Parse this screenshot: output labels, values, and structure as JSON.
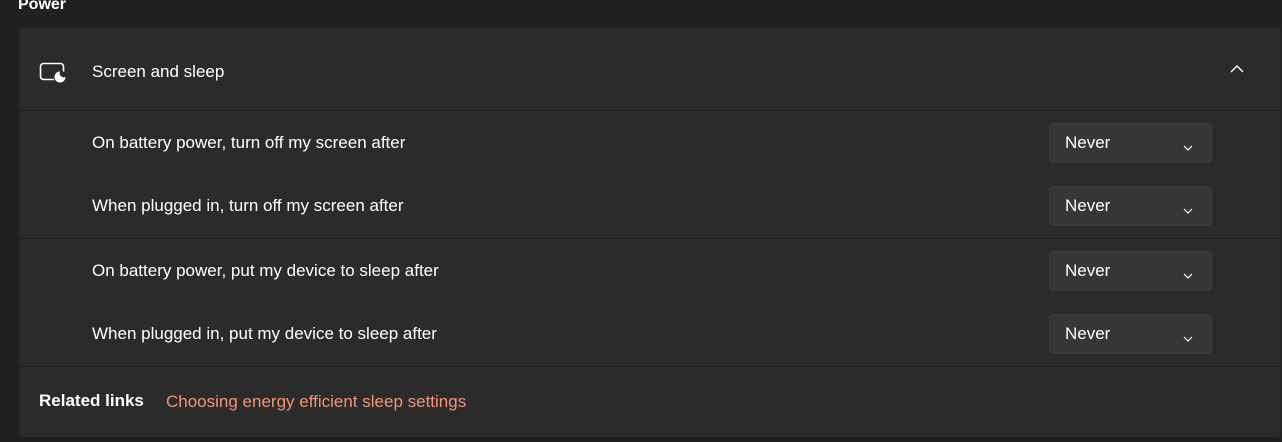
{
  "section": {
    "title": "Power"
  },
  "screen_sleep": {
    "title": "Screen and sleep",
    "icon": "screen-sleep-icon",
    "expanded": true
  },
  "settings": [
    {
      "label": "On battery power, turn off my screen after",
      "value": "Never"
    },
    {
      "label": "When plugged in, turn off my screen after",
      "value": "Never"
    },
    {
      "label": "On battery power, put my device to sleep after",
      "value": "Never"
    },
    {
      "label": "When plugged in, put my device to sleep after",
      "value": "Never"
    }
  ],
  "related": {
    "label": "Related links",
    "link": "Choosing energy efficient sleep settings"
  },
  "colors": {
    "background": "#202020",
    "panel": "#2b2b2b",
    "dropdown": "#373737",
    "link": "#f1947a"
  }
}
